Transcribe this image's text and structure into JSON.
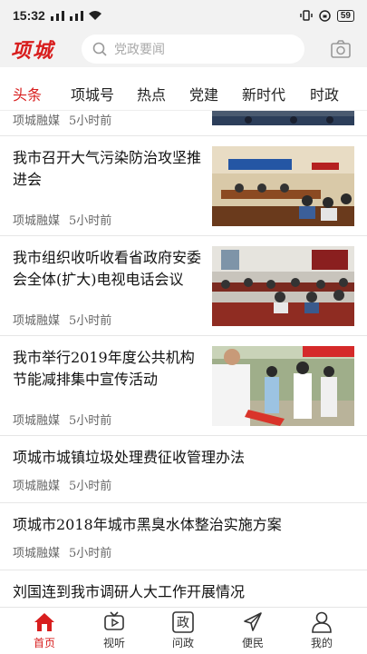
{
  "status": {
    "time": "15:32",
    "battery": "59"
  },
  "header": {
    "logo": "项城",
    "search_placeholder": "党政要闻"
  },
  "tabs": [
    {
      "label": "头条",
      "active": true
    },
    {
      "label": "项城号",
      "active": false
    },
    {
      "label": "热点",
      "active": false
    },
    {
      "label": "党建",
      "active": false
    },
    {
      "label": "新时代",
      "active": false
    },
    {
      "label": "时政",
      "active": false
    }
  ],
  "feed": {
    "partial": {
      "source": "项城融媒",
      "time": "5小时前"
    },
    "items": [
      {
        "title": "我市召开大气污染防治攻坚推进会",
        "source": "项城融媒",
        "time": "5小时前",
        "has_image": true
      },
      {
        "title": "我市组织收听收看省政府安委会全体(扩大)电视电话会议",
        "source": "项城融媒",
        "time": "5小时前",
        "has_image": true
      },
      {
        "title": "我市举行2019年度公共机构节能减排集中宣传活动",
        "source": "项城融媒",
        "time": "5小时前",
        "has_image": true
      },
      {
        "title": "项城市城镇垃圾处理费征收管理办法",
        "source": "项城融媒",
        "time": "5小时前",
        "has_image": false
      },
      {
        "title": "项城市2018年城市黑臭水体整治实施方案",
        "source": "项城融媒",
        "time": "5小时前",
        "has_image": false
      },
      {
        "title": "刘国连到我市调研人大工作开展情况",
        "source": "",
        "time": "",
        "has_image": false
      }
    ]
  },
  "nav": [
    {
      "label": "首页",
      "icon": "home-icon",
      "active": true
    },
    {
      "label": "视听",
      "icon": "tv-icon",
      "active": false
    },
    {
      "label": "问政",
      "icon": "zheng-icon",
      "active": false
    },
    {
      "label": "便民",
      "icon": "send-icon",
      "active": false
    },
    {
      "label": "我的",
      "icon": "user-icon",
      "active": false
    }
  ],
  "colors": {
    "accent": "#d81e1e"
  }
}
